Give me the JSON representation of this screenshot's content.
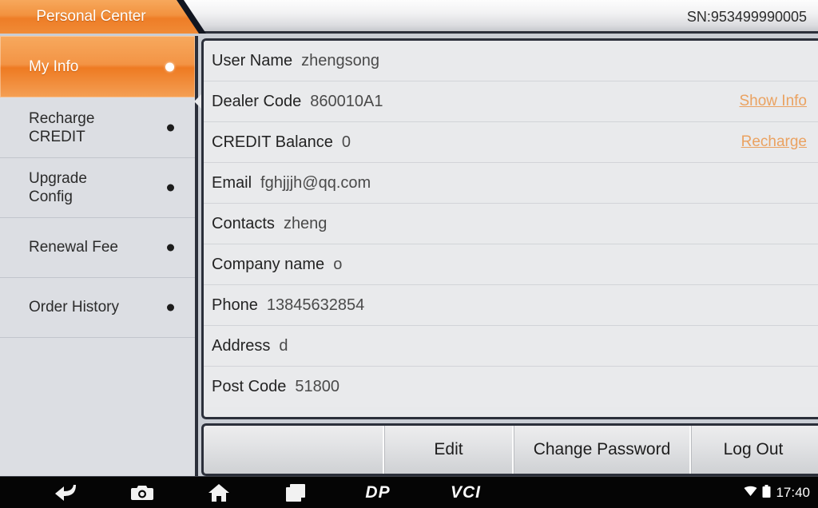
{
  "header": {
    "tab_label": "Personal Center",
    "sn": "SN:953499990005"
  },
  "sidebar": {
    "items": [
      {
        "label": "My Info",
        "selected": true
      },
      {
        "label": "Recharge\nCREDIT",
        "selected": false
      },
      {
        "label": "Upgrade\nConfig",
        "selected": false
      },
      {
        "label": "Renewal Fee",
        "selected": false
      },
      {
        "label": "Order History",
        "selected": false
      }
    ]
  },
  "main": {
    "rows": [
      {
        "label": "User Name",
        "value": "zhengsong",
        "link": ""
      },
      {
        "label": "Dealer Code",
        "value": "860010A1",
        "link": "Show Info"
      },
      {
        "label": "CREDIT Balance",
        "value": "0",
        "link": "Recharge"
      },
      {
        "label": "Email",
        "value": "fghjjjh@qq.com",
        "link": ""
      },
      {
        "label": "Contacts",
        "value": "zheng",
        "link": ""
      },
      {
        "label": "Company name",
        "value": "o",
        "link": ""
      },
      {
        "label": "Phone",
        "value": "13845632854",
        "link": ""
      },
      {
        "label": "Address",
        "value": "d",
        "link": ""
      },
      {
        "label": "Post Code",
        "value": "51800",
        "link": ""
      }
    ]
  },
  "buttons": {
    "edit": "Edit",
    "change_password": "Change Password",
    "log_out": "Log Out"
  },
  "navbar": {
    "back": "back-icon",
    "camera": "camera-icon",
    "home": "home-icon",
    "recents": "recent-apps-icon",
    "dp_logo": "DP",
    "vci_label": "VCI",
    "wifi": "wifi-icon",
    "battery": "battery-icon",
    "clock": "17:40"
  },
  "colors": {
    "accent_orange": "#ee7d27",
    "link_orange": "#eaa261",
    "panel_bg": "#e8e9eb",
    "sidebar_bg": "#dcdee3",
    "border_dark": "#2b2f3a"
  }
}
